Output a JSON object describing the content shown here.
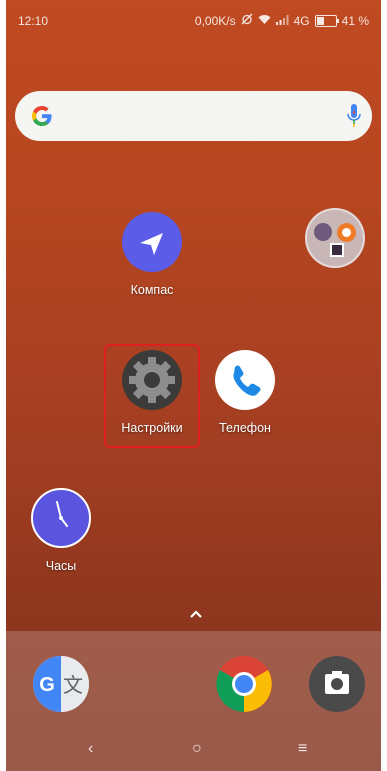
{
  "status_bar": {
    "time": "12:10",
    "speed": "0,00K/s",
    "network": "4G",
    "battery_level": 0.41,
    "battery_text": "41 %"
  },
  "search": {
    "icons": [
      "google-g-icon",
      "microphone-icon"
    ]
  },
  "apps": {
    "compass": {
      "label": "Компас"
    },
    "folder": {
      "label": ""
    },
    "settings": {
      "label": "Настройки"
    },
    "phone": {
      "label": "Телефон"
    },
    "clock": {
      "label": "Часы"
    }
  },
  "dock": {
    "apps": [
      "translate-icon",
      "chrome-icon",
      "camera-icon"
    ]
  },
  "navbar": {
    "back": "‹",
    "home": "○",
    "menu": "≡"
  },
  "colors": {
    "wallpaper_top": "#c04a22",
    "wallpaper_bottom": "#7e321d",
    "highlight": "#e01f1f",
    "compass_bg": "#5b5ce8",
    "clock_bg": "#5a54de",
    "phone_icon": "#1e88e5"
  }
}
